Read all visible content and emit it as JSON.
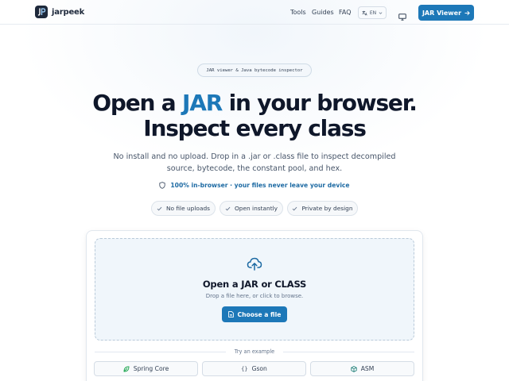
{
  "header": {
    "brand": "jarpeek",
    "nav": [
      "Tools",
      "Guides",
      "FAQ"
    ],
    "language": "EN",
    "cta_label": "JAR Viewer"
  },
  "hero": {
    "pill": "JAR viewer & Java bytecode inspector",
    "title_line1_pre": "Open a ",
    "title_line1_accent": "JAR",
    "title_line1_post": " in your browser.",
    "title_line2": "Inspect every class",
    "subtitle_line1": "No install and no upload. Drop in a .jar or .class file to inspect decompiled",
    "subtitle_line2": "source, bytecode, the constant pool, and hex.",
    "secure_note": "100% in-browser · your files never leave your device",
    "chips": [
      "No file uploads",
      "Open instantly",
      "Private by design"
    ]
  },
  "upload": {
    "title": "Open a JAR or CLASS",
    "hint": "Drop a file here, or click to browse.",
    "button_label": "Choose a file",
    "examples_label": "Try an example",
    "examples": [
      "Spring Core",
      "Gson",
      "ASM"
    ]
  },
  "colors": {
    "accent": "#1d78b8",
    "text": "#0f172a",
    "muted": "#64748b"
  }
}
